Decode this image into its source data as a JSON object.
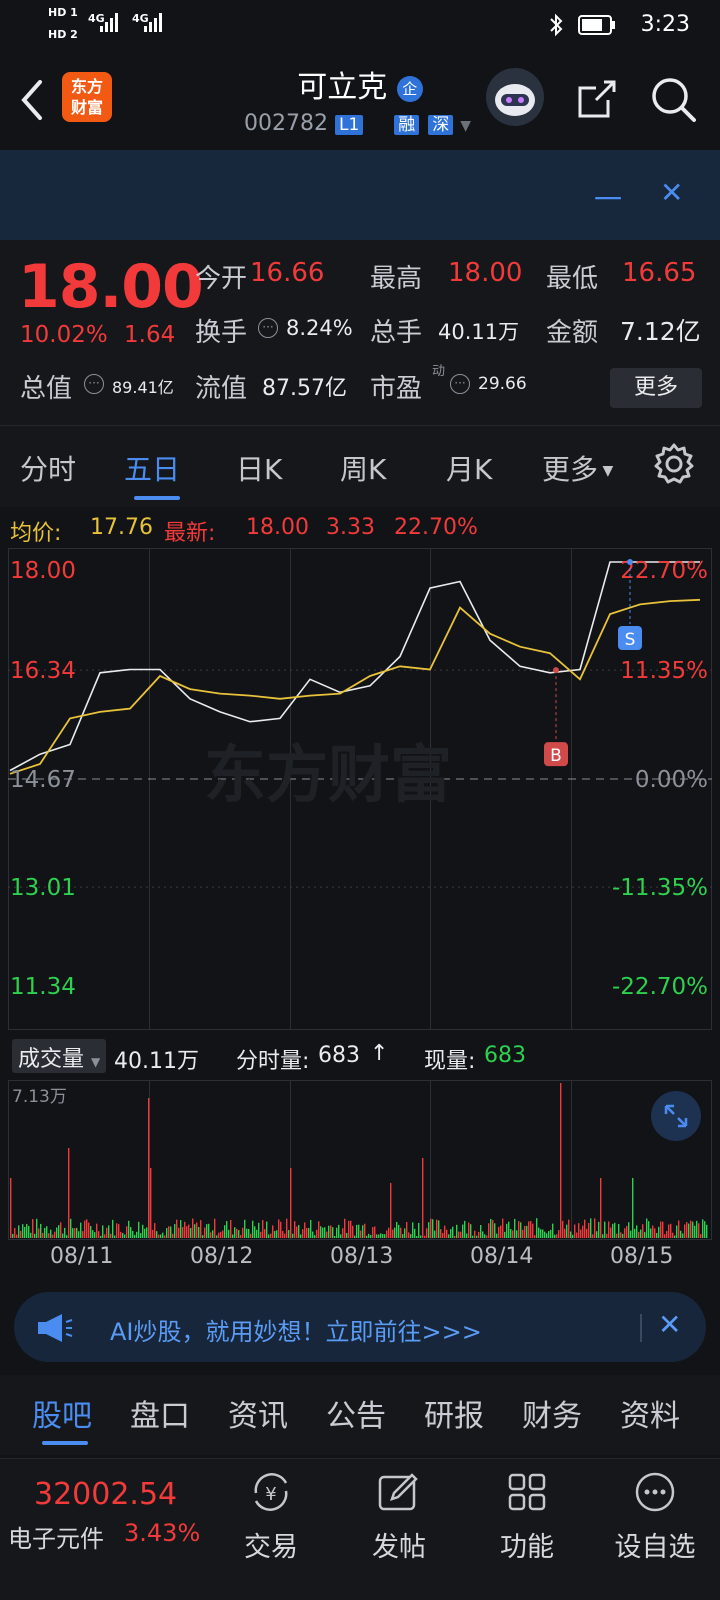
{
  "status_bar": {
    "net1": "HD 1",
    "net2": "HD 2",
    "sig1": "4G",
    "sig2": "4G",
    "time": "3:23"
  },
  "header": {
    "logo_line1": "东方",
    "logo_line2": "财富",
    "title": "可立克",
    "title_badge": "企",
    "code": "002782",
    "level": "L1",
    "tag_rong": "融",
    "tag_shen": "深"
  },
  "notice": {
    "text": "一",
    "close": "✕"
  },
  "quote": {
    "price": "18.00",
    "change_pct": "10.02%",
    "change_amt": "1.64",
    "open_label": "今开",
    "open": "16.66",
    "high_label": "最高",
    "high": "18.00",
    "low_label": "最低",
    "low": "16.65",
    "turnover_label": "换手",
    "turnover": "8.24%",
    "volume_label": "总手",
    "volume": "40.11万",
    "amount_label": "金额",
    "amount": "7.12亿",
    "mcap_label": "总值",
    "mcap": "89.41亿",
    "float_label": "流值",
    "float": "87.57亿",
    "pe_label": "市盈",
    "pe_sup": "动",
    "pe": "29.66",
    "more_button": "更多"
  },
  "chart_tabs": [
    "分时",
    "五日",
    "日K",
    "周K",
    "月K",
    "更多"
  ],
  "chart_info": {
    "avg_label": "均价:",
    "avg_value": "17.76",
    "latest_label": "最新:",
    "latest_value": "18.00",
    "latest_change": "3.33",
    "latest_pct": "22.70%"
  },
  "chart_data": {
    "type": "line",
    "title": "",
    "y_left_ticks": [
      "18.00",
      "16.34",
      "14.67",
      "13.01",
      "11.34"
    ],
    "y_right_ticks": [
      "22.70%",
      "11.35%",
      "0.00%",
      "-11.35%",
      "-22.70%"
    ],
    "ylim": [
      11.34,
      18.0
    ],
    "baseline": 14.67,
    "x_dates": [
      "08/11",
      "08/12",
      "08/13",
      "08/14",
      "08/15"
    ],
    "series": [
      {
        "values": [
          14.8,
          15.05,
          15.2,
          16.3,
          16.35,
          16.35,
          15.9,
          15.7,
          15.55,
          15.6,
          16.2,
          16.0,
          16.1,
          16.55,
          17.6,
          17.7,
          16.8,
          16.4,
          16.3,
          16.35,
          18.0,
          18.0,
          18.0,
          18.0
        ]
      },
      {
        "values": [
          14.75,
          14.9,
          15.6,
          15.7,
          15.75,
          16.25,
          16.05,
          15.98,
          15.95,
          15.9,
          15.95,
          15.98,
          16.25,
          16.4,
          16.35,
          17.3,
          16.9,
          16.7,
          16.6,
          16.2,
          17.2,
          17.35,
          17.4,
          17.42
        ]
      }
    ],
    "markers": [
      {
        "label": "B",
        "value": 16.34
      },
      {
        "label": "S",
        "value": 18.0
      }
    ],
    "watermark": "东方财富"
  },
  "volume": {
    "label": "成交量",
    "total": "40.11万",
    "tick_label": "分时量:",
    "tick_value": "683",
    "tick_arrow": "↑",
    "now_label": "现量:",
    "now_value": "683",
    "max_label": "7.13万"
  },
  "ai_banner": {
    "text": "AI炒股，就用妙想！立即前往>>>",
    "close": "✕"
  },
  "bottom_tabs": [
    "股吧",
    "盘口",
    "资讯",
    "公告",
    "研报",
    "财务",
    "资料"
  ],
  "footer": {
    "index_value": "32002.54",
    "sector_name": "电子元件",
    "sector_pct": "3.43%",
    "trade": "交易",
    "post": "发帖",
    "function": "功能",
    "watchlist": "设自选"
  },
  "colors": {
    "up": "#f23a3a",
    "down": "#2ed04f",
    "accent": "#4a8cf0",
    "avg": "#e8c23a"
  }
}
